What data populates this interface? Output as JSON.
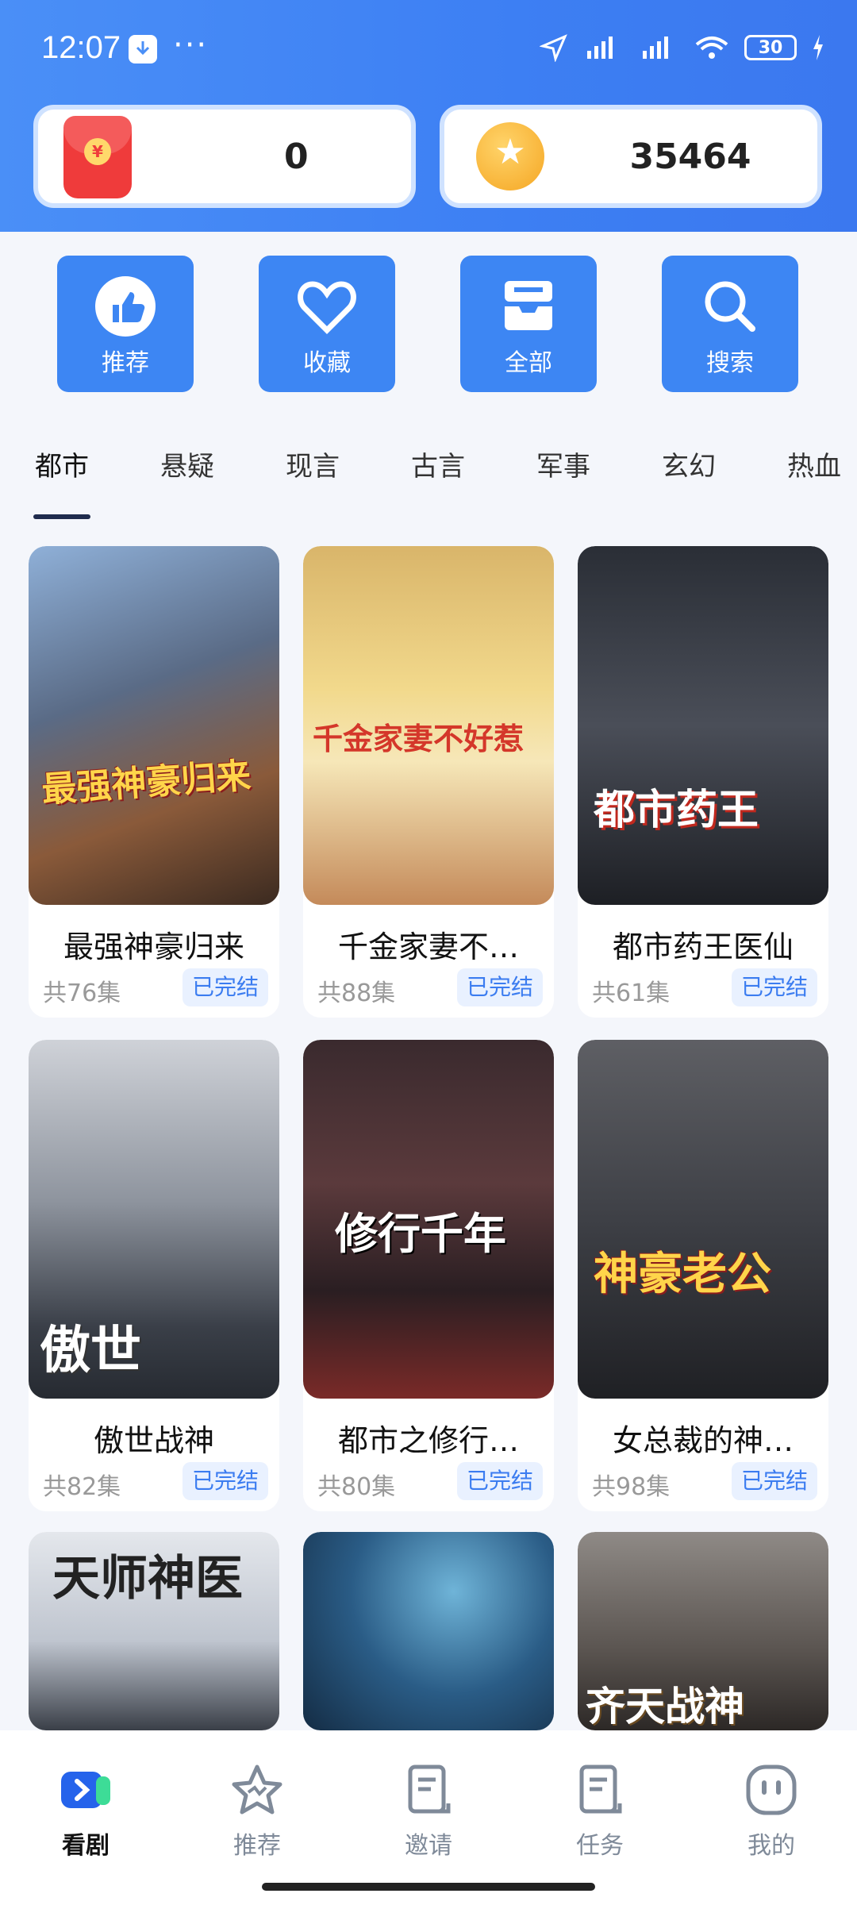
{
  "status": {
    "time": "12:07",
    "dots": "···",
    "battery": "30"
  },
  "wallet": {
    "cash": "0",
    "coins": "35464",
    "cash_icon_glyph": "¥",
    "coin_icon_glyph": "★"
  },
  "quick_actions": [
    {
      "label": "推荐",
      "icon": "thumbs-up-icon"
    },
    {
      "label": "收藏",
      "icon": "heart-icon"
    },
    {
      "label": "全部",
      "icon": "tray-icon"
    },
    {
      "label": "搜索",
      "icon": "search-icon"
    }
  ],
  "tabs": [
    "都市",
    "悬疑",
    "现言",
    "古言",
    "军事",
    "玄幻",
    "热血"
  ],
  "dramas": [
    {
      "title": "最强神豪归来",
      "episodes": "共76集",
      "status": "已完结",
      "poster_text": "最强神豪归来"
    },
    {
      "title": "千金家妻不…",
      "episodes": "共88集",
      "status": "已完结",
      "poster_text": "千金家妻不好惹"
    },
    {
      "title": "都市药王医仙",
      "episodes": "共61集",
      "status": "已完结",
      "poster_text": "都市药王"
    },
    {
      "title": "傲世战神",
      "episodes": "共82集",
      "status": "已完结",
      "poster_text": "傲世"
    },
    {
      "title": "都市之修行…",
      "episodes": "共80集",
      "status": "已完结",
      "poster_text": "修行千年"
    },
    {
      "title": "女总裁的神…",
      "episodes": "共98集",
      "status": "已完结",
      "poster_text": "神豪老公"
    },
    {
      "poster_text": "天师神医"
    },
    {
      "poster_text": ""
    },
    {
      "poster_text": "齐天战神"
    }
  ],
  "bottom_nav": [
    {
      "label": "看剧",
      "icon": "play-icon",
      "active": true
    },
    {
      "label": "推荐",
      "icon": "star-icon",
      "active": false
    },
    {
      "label": "邀请",
      "icon": "scroll-icon",
      "active": false
    },
    {
      "label": "任务",
      "icon": "task-icon",
      "active": false
    },
    {
      "label": "我的",
      "icon": "profile-icon",
      "active": false
    }
  ],
  "colors": {
    "primary": "#3d86f3",
    "header": "#4a8ff7",
    "badge_text": "#3b7cf0"
  }
}
